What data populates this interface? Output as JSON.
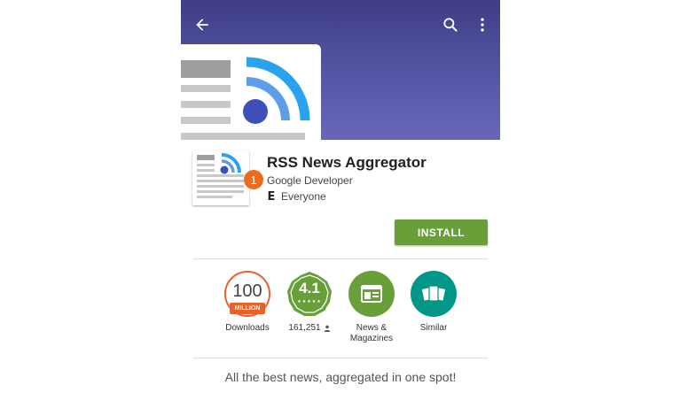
{
  "toolbar": {
    "back_icon": "arrow-back-icon",
    "search_icon": "search-icon",
    "more_icon": "more-vert-icon"
  },
  "app": {
    "title": "RSS News Aggregator",
    "developer": "Google Developer",
    "content_rating": "Everyone",
    "content_rating_icon": "E",
    "callout_number": "1",
    "install_label": "INSTALL"
  },
  "badges": {
    "downloads": {
      "value": "100",
      "unit": "MILLION",
      "label": "Downloads"
    },
    "rating": {
      "value": "4.1",
      "stars": "★★★★★",
      "reviews": "161,251",
      "reviews_icon": "person-icon"
    },
    "category": {
      "label": "News &\nMagazines",
      "icon": "newspaper-icon"
    },
    "similar": {
      "label": "Similar",
      "icon": "similar-cards-icon"
    }
  },
  "description": "All the best news, aggregated in one spot!",
  "colors": {
    "banner": "#5656a6",
    "install": "#689f38",
    "downloads": "#e8612c",
    "similar": "#009688",
    "rss_blue": "#2aa3ef",
    "rss_dot": "#3d4fb8"
  }
}
